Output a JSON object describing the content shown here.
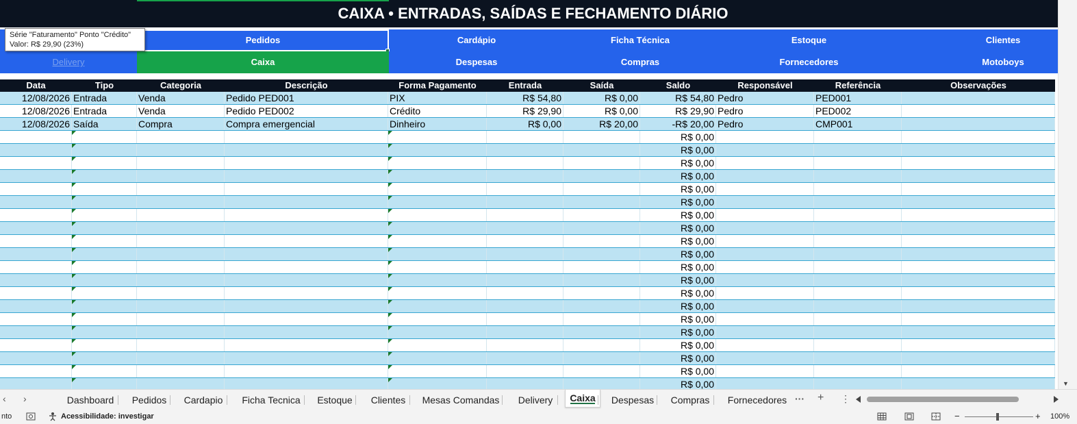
{
  "title": "CAIXA • ENTRADAS, SAÍDAS E FECHAMENTO DIÁRIO",
  "tooltip": {
    "line1": "Série \"Faturamento\" Ponto \"Crédito\"",
    "line2": "Valor: R$ 29,90 (23%)"
  },
  "nav_row1": [
    "",
    "Pedidos",
    "Cardápio",
    "Ficha Técnica",
    "Estoque",
    "Clientes"
  ],
  "nav_row2": [
    "Delivery",
    "Caixa",
    "Despesas",
    "Compras",
    "Fornecedores",
    "Motoboys"
  ],
  "columns": [
    "Data",
    "Tipo",
    "Categoria",
    "Descrição",
    "Forma Pagamento",
    "Entrada",
    "Saída",
    "Saldo",
    "Responsável",
    "Referência",
    "Observações"
  ],
  "rows": [
    [
      "12/08/2026",
      "Entrada",
      "Venda",
      "Pedido PED001",
      "PIX",
      "R$ 54,80",
      "R$ 0,00",
      "R$ 54,80",
      "Pedro",
      "PED001",
      ""
    ],
    [
      "12/08/2026",
      "Entrada",
      "Venda",
      "Pedido PED002",
      "Crédito",
      "R$ 29,90",
      "R$ 0,00",
      "R$ 29,90",
      "Pedro",
      "PED002",
      ""
    ],
    [
      "12/08/2026",
      "Saída",
      "Compra",
      "Compra emergencial",
      "Dinheiro",
      "R$ 0,00",
      "R$ 20,00",
      "-R$ 20,00",
      "Pedro",
      "CMP001",
      ""
    ],
    [
      "",
      "",
      "",
      "",
      "",
      "",
      "",
      "R$ 0,00",
      "",
      "",
      ""
    ],
    [
      "",
      "",
      "",
      "",
      "",
      "",
      "",
      "R$ 0,00",
      "",
      "",
      ""
    ],
    [
      "",
      "",
      "",
      "",
      "",
      "",
      "",
      "R$ 0,00",
      "",
      "",
      ""
    ],
    [
      "",
      "",
      "",
      "",
      "",
      "",
      "",
      "R$ 0,00",
      "",
      "",
      ""
    ],
    [
      "",
      "",
      "",
      "",
      "",
      "",
      "",
      "R$ 0,00",
      "",
      "",
      ""
    ],
    [
      "",
      "",
      "",
      "",
      "",
      "",
      "",
      "R$ 0,00",
      "",
      "",
      ""
    ],
    [
      "",
      "",
      "",
      "",
      "",
      "",
      "",
      "R$ 0,00",
      "",
      "",
      ""
    ],
    [
      "",
      "",
      "",
      "",
      "",
      "",
      "",
      "R$ 0,00",
      "",
      "",
      ""
    ],
    [
      "",
      "",
      "",
      "",
      "",
      "",
      "",
      "R$ 0,00",
      "",
      "",
      ""
    ],
    [
      "",
      "",
      "",
      "",
      "",
      "",
      "",
      "R$ 0,00",
      "",
      "",
      ""
    ],
    [
      "",
      "",
      "",
      "",
      "",
      "",
      "",
      "R$ 0,00",
      "",
      "",
      ""
    ],
    [
      "",
      "",
      "",
      "",
      "",
      "",
      "",
      "R$ 0,00",
      "",
      "",
      ""
    ],
    [
      "",
      "",
      "",
      "",
      "",
      "",
      "",
      "R$ 0,00",
      "",
      "",
      ""
    ],
    [
      "",
      "",
      "",
      "",
      "",
      "",
      "",
      "R$ 0,00",
      "",
      "",
      ""
    ],
    [
      "",
      "",
      "",
      "",
      "",
      "",
      "",
      "R$ 0,00",
      "",
      "",
      ""
    ],
    [
      "",
      "",
      "",
      "",
      "",
      "",
      "",
      "R$ 0,00",
      "",
      "",
      ""
    ],
    [
      "",
      "",
      "",
      "",
      "",
      "",
      "",
      "R$ 0,00",
      "",
      "",
      ""
    ],
    [
      "",
      "",
      "",
      "",
      "",
      "",
      "",
      "R$ 0,00",
      "",
      "",
      ""
    ],
    [
      "",
      "",
      "",
      "",
      "",
      "",
      "",
      "R$ 0,00",
      "",
      "",
      ""
    ],
    [
      "",
      "",
      "",
      "",
      "",
      "",
      "",
      "R$ 0,00",
      "",
      "",
      ""
    ]
  ],
  "sheet_tabs": [
    "Dashboard",
    "Pedidos",
    "Cardapio",
    "Ficha Tecnica",
    "Estoque",
    "Clientes",
    "Mesas Comandas",
    "Delivery",
    "Caixa",
    "Despesas",
    "Compras",
    "Fornecedores"
  ],
  "active_tab": "Caixa",
  "tab_controls": {
    "prev": "‹",
    "next": "›",
    "more": "···",
    "add": "+",
    "options": "⋮"
  },
  "status": {
    "left_text": "nto",
    "accessibility": "Acessibilidade: investigar",
    "zoom": "100%",
    "zoom_minus": "−",
    "zoom_plus": "+"
  },
  "colors": {
    "title_bg": "#0b1320",
    "nav_blue": "#2563eb",
    "active_green": "#16a34a",
    "row_blue": "#bde3f3",
    "row_border": "#38a6d1"
  }
}
